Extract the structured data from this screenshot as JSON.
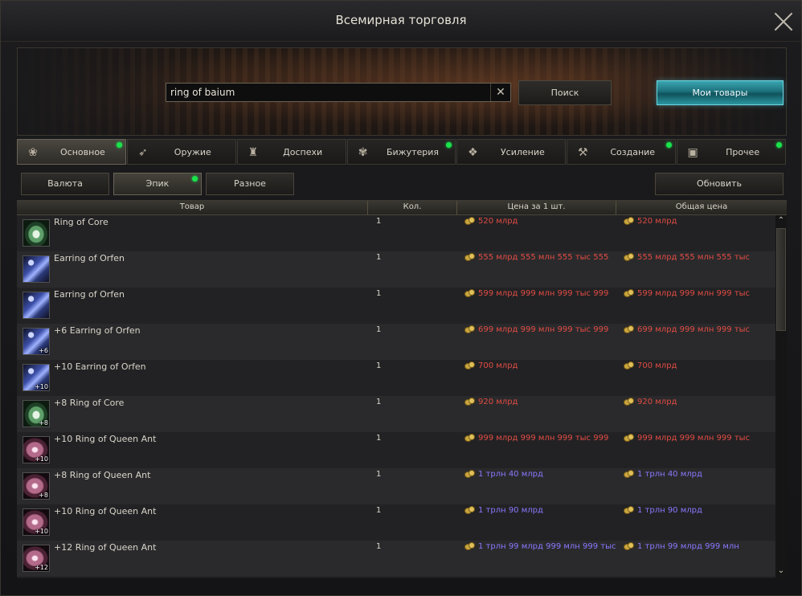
{
  "window": {
    "title": "Всемирная торговля"
  },
  "search": {
    "value": "ring of baium",
    "clear": "✕",
    "button": "Поиск"
  },
  "my_items_button": "Мои товары",
  "tabs": [
    {
      "label": "Основное",
      "icon": "basic-icon",
      "dot": true,
      "active": true
    },
    {
      "label": "Оружие",
      "icon": "weapon-icon",
      "dot": false
    },
    {
      "label": "Доспехи",
      "icon": "armor-icon",
      "dot": false
    },
    {
      "label": "Бижутерия",
      "icon": "jewelry-icon",
      "dot": true
    },
    {
      "label": "Усиление",
      "icon": "enhance-icon",
      "dot": false
    },
    {
      "label": "Создание",
      "icon": "craft-icon",
      "dot": true
    },
    {
      "label": "Прочее",
      "icon": "misc-icon",
      "dot": true
    }
  ],
  "subtabs": [
    {
      "label": "Валюта"
    },
    {
      "label": "Эпик",
      "dot": true,
      "active": true
    },
    {
      "label": "Разное"
    }
  ],
  "refresh_button": "Обновить",
  "columns": {
    "item": "Товар",
    "qty": "Кол.",
    "unit_price": "Цена за 1 шт.",
    "total_price": "Общая цена"
  },
  "rows": [
    {
      "name": "Ring of Core",
      "qty": "1",
      "unit": "520 млрд",
      "total": "520 млрд",
      "color": "red",
      "icon": "ring-core-icon",
      "enchant": ""
    },
    {
      "name": "Earring of Orfen",
      "qty": "1",
      "unit": "555 млрд 555 млн 555 тыс 555",
      "total": "555 млрд 555 млн 555 тыс",
      "color": "red",
      "icon": "earring-orfen-icon",
      "enchant": ""
    },
    {
      "name": "Earring of Orfen",
      "qty": "1",
      "unit": "599 млрд 999 млн 999 тыс 999",
      "total": "599 млрд 999 млн 999 тыс",
      "color": "red",
      "icon": "earring-orfen-icon",
      "enchant": ""
    },
    {
      "name": "+6 Earring of Orfen",
      "qty": "1",
      "unit": "699 млрд 999 млн 999 тыс 999",
      "total": "699 млрд 999 млн 999 тыс",
      "color": "red",
      "icon": "earring-orfen-icon",
      "enchant": "+6"
    },
    {
      "name": "+10 Earring of Orfen",
      "qty": "1",
      "unit": "700 млрд",
      "total": "700 млрд",
      "color": "red",
      "icon": "earring-orfen-icon",
      "enchant": "+10"
    },
    {
      "name": "+8 Ring of Core",
      "qty": "1",
      "unit": "920 млрд",
      "total": "920 млрд",
      "color": "red",
      "icon": "ring-core-icon",
      "enchant": "+8"
    },
    {
      "name": "+10 Ring of Queen Ant",
      "qty": "1",
      "unit": "999 млрд 999 млн 999 тыс 999",
      "total": "999 млрд 999 млн 999 тыс",
      "color": "red",
      "icon": "ring-queen-ant-icon",
      "enchant": "+10"
    },
    {
      "name": "+8 Ring of Queen Ant",
      "qty": "1",
      "unit": "1 трлн 40 млрд",
      "total": "1 трлн 40 млрд",
      "color": "blue",
      "icon": "ring-queen-ant-icon",
      "enchant": "+8"
    },
    {
      "name": "+10 Ring of Queen Ant",
      "qty": "1",
      "unit": "1 трлн 90 млрд",
      "total": "1 трлн 90 млрд",
      "color": "blue",
      "icon": "ring-queen-ant-icon",
      "enchant": "+10"
    },
    {
      "name": "+12 Ring of Queen Ant",
      "qty": "1",
      "unit": "1 трлн 99 млрд 999 млн 999 тыс",
      "total": "1 трлн 99 млрд 999 млн",
      "color": "blue",
      "icon": "ring-queen-ant-icon",
      "enchant": "+12"
    }
  ],
  "scrollbar": {
    "up": "⌃",
    "down": "⌄"
  },
  "colors": {
    "price_red": "#e24c44",
    "price_blue": "#8a78ff",
    "new_dot": "#19e34b",
    "accent_teal": "#2b97a2"
  }
}
